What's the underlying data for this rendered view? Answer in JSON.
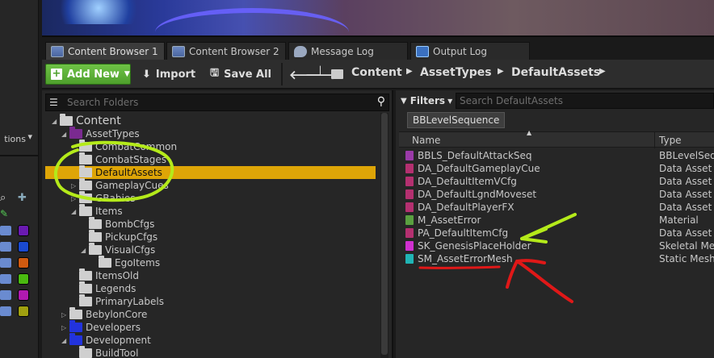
{
  "left_strip": {
    "dropdown_partial": "tions"
  },
  "tabs": [
    {
      "label": "Content Browser 1",
      "icon": "content-browser-icon",
      "active": true
    },
    {
      "label": "Content Browser 2",
      "icon": "content-browser-icon",
      "active": false
    },
    {
      "label": "Message Log",
      "icon": "message-log-icon",
      "active": false
    },
    {
      "label": "Output Log",
      "icon": "output-log-icon",
      "active": false
    }
  ],
  "toolbar": {
    "add_new": "Add New",
    "import": "Import",
    "save_all": "Save All",
    "breadcrumb": [
      "Content",
      "AssetTypes",
      "DefaultAssets"
    ]
  },
  "folders": {
    "search_placeholder": "Search Folders",
    "tree": [
      {
        "label": "Content",
        "depth": 0,
        "expanded": true,
        "color": "plain"
      },
      {
        "label": "AssetTypes",
        "depth": 1,
        "expanded": true,
        "color": "purple"
      },
      {
        "label": "CombatCommon",
        "depth": 2,
        "color": "plain"
      },
      {
        "label": "CombatStages",
        "depth": 2,
        "color": "plain"
      },
      {
        "label": "DefaultAssets",
        "depth": 2,
        "color": "plain",
        "selected": true
      },
      {
        "label": "GameplayCues",
        "depth": 2,
        "collapsed": true,
        "color": "plain"
      },
      {
        "label": "GBabies",
        "depth": 2,
        "collapsed": true,
        "color": "plain"
      },
      {
        "label": "Items",
        "depth": 2,
        "expanded": true,
        "color": "plain"
      },
      {
        "label": "BombCfgs",
        "depth": 3,
        "color": "plain"
      },
      {
        "label": "PickupCfgs",
        "depth": 3,
        "color": "plain"
      },
      {
        "label": "VisualCfgs",
        "depth": 3,
        "expanded": true,
        "color": "plain"
      },
      {
        "label": "EgoItems",
        "depth": 4,
        "color": "plain"
      },
      {
        "label": "ItemsOld",
        "depth": 2,
        "color": "plain"
      },
      {
        "label": "Legends",
        "depth": 2,
        "color": "plain"
      },
      {
        "label": "PrimaryLabels",
        "depth": 2,
        "color": "plain"
      },
      {
        "label": "BebylonCore",
        "depth": 1,
        "collapsed": true,
        "color": "plain"
      },
      {
        "label": "Developers",
        "depth": 1,
        "collapsed": true,
        "color": "blue"
      },
      {
        "label": "Development",
        "depth": 1,
        "expanded": true,
        "color": "blue"
      },
      {
        "label": "BuildTool",
        "depth": 2,
        "color": "plain"
      }
    ]
  },
  "assets": {
    "filters_label": "Filters",
    "search_placeholder": "Search DefaultAssets",
    "active_filter": "BBLevelSequence",
    "col_name": "Name",
    "col_type": "Type",
    "rows": [
      {
        "name": "BBLS_DefaultAttackSeq",
        "type": "BBLevelSequ",
        "icon": "ls"
      },
      {
        "name": "DA_DefaultGameplayCue",
        "type": "Data Asset",
        "icon": "da"
      },
      {
        "name": "DA_DefaultItemVCfg",
        "type": "Data Asset",
        "icon": "da"
      },
      {
        "name": "DA_DefaultLgndMoveset",
        "type": "Data Asset",
        "icon": "da"
      },
      {
        "name": "DA_DefaultPlayerFX",
        "type": "Data Asset",
        "icon": "da"
      },
      {
        "name": "M_AssetError",
        "type": "Material",
        "icon": "mat"
      },
      {
        "name": "PA_DefaultItemCfg",
        "type": "Data Asset",
        "icon": "da"
      },
      {
        "name": "SK_GenesisPlaceHolder",
        "type": "Skeletal Mes",
        "icon": "sk"
      },
      {
        "name": "SM_AssetErrorMesh",
        "type": "Static Mesh",
        "icon": "sm"
      }
    ]
  },
  "colors": {
    "selection": "#dea507",
    "add_button": "#5aae36",
    "annotation_green": "#b4ea1a",
    "annotation_red": "#e01818"
  }
}
